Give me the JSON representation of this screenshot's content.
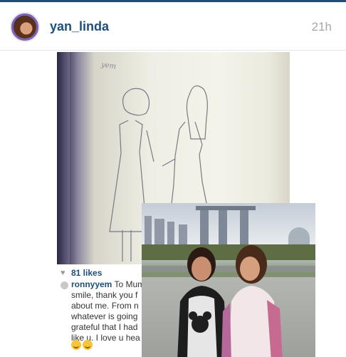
{
  "post": {
    "username": "yan_linda",
    "time_ago": "21h",
    "likes": "81 likes",
    "caption": {
      "username": "ronnyyem",
      "lines": [
        "To Mum",
        "smile, thank you f",
        "about me. From n",
        "whatever is going",
        "grateful that I had",
        "like u. I love u hea"
      ]
    },
    "sketch_signature": "yem"
  },
  "icons": {
    "likes": "heart-icon",
    "comment": "comment-bubble-icon"
  },
  "colors": {
    "username": "#1d4f7c",
    "top_bar": "#1e4f7c",
    "timestamp": "#a7a7a7"
  }
}
